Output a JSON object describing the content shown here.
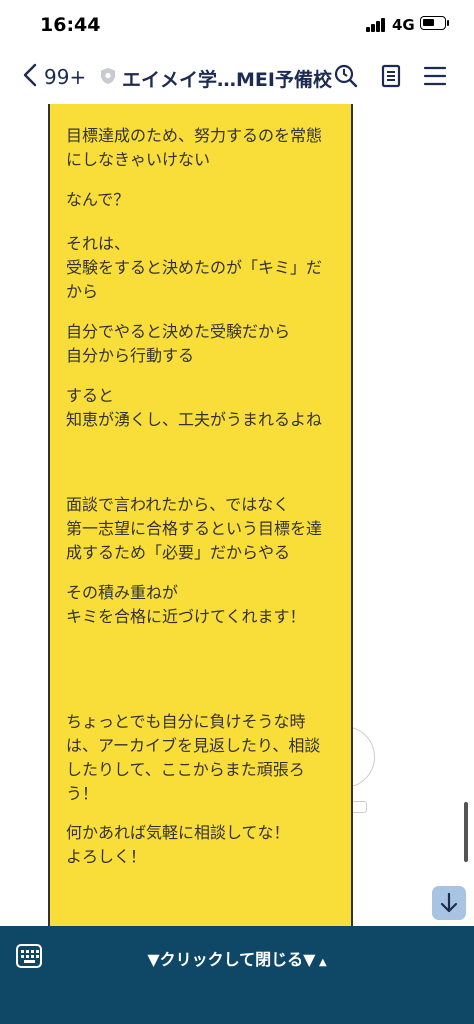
{
  "status": {
    "time": "16:44",
    "network": "4G"
  },
  "header": {
    "back_count": "99+",
    "title": "エイメイ学…MEI予備校",
    "icons": [
      "back-chevron-icon",
      "shield-icon",
      "search-icon",
      "notes-icon",
      "menu-icon"
    ]
  },
  "message": {
    "background": "#f9dd38",
    "paragraphs": [
      "目標達成のため、努力するのを常態\nにしなきゃいけない",
      "なんで？",
      "それは、\n受験をすると決めたのが「キミ」だ\nから",
      "自分でやると決めた受験だから\n自分から行動する",
      "すると\n知恵が湧くし、工夫がうまれるよね",
      "面談で言われたから、ではなく\n第一志望に合格するという目標を達\n成するため「必要」だからやる",
      "その積み重ねが\nキミを合格に近づけてくれます！",
      "ちょっとでも自分に負けそうな時\nは、アーカイブを見返したり、相談\nしたりして、ここからまた頑張ろ\nう！",
      "何かあれば気軽に相談してな！\nよろしく！"
    ]
  },
  "bottom_bar": {
    "label": "▼クリックして閉じる▼",
    "accent": "#0f4866"
  }
}
